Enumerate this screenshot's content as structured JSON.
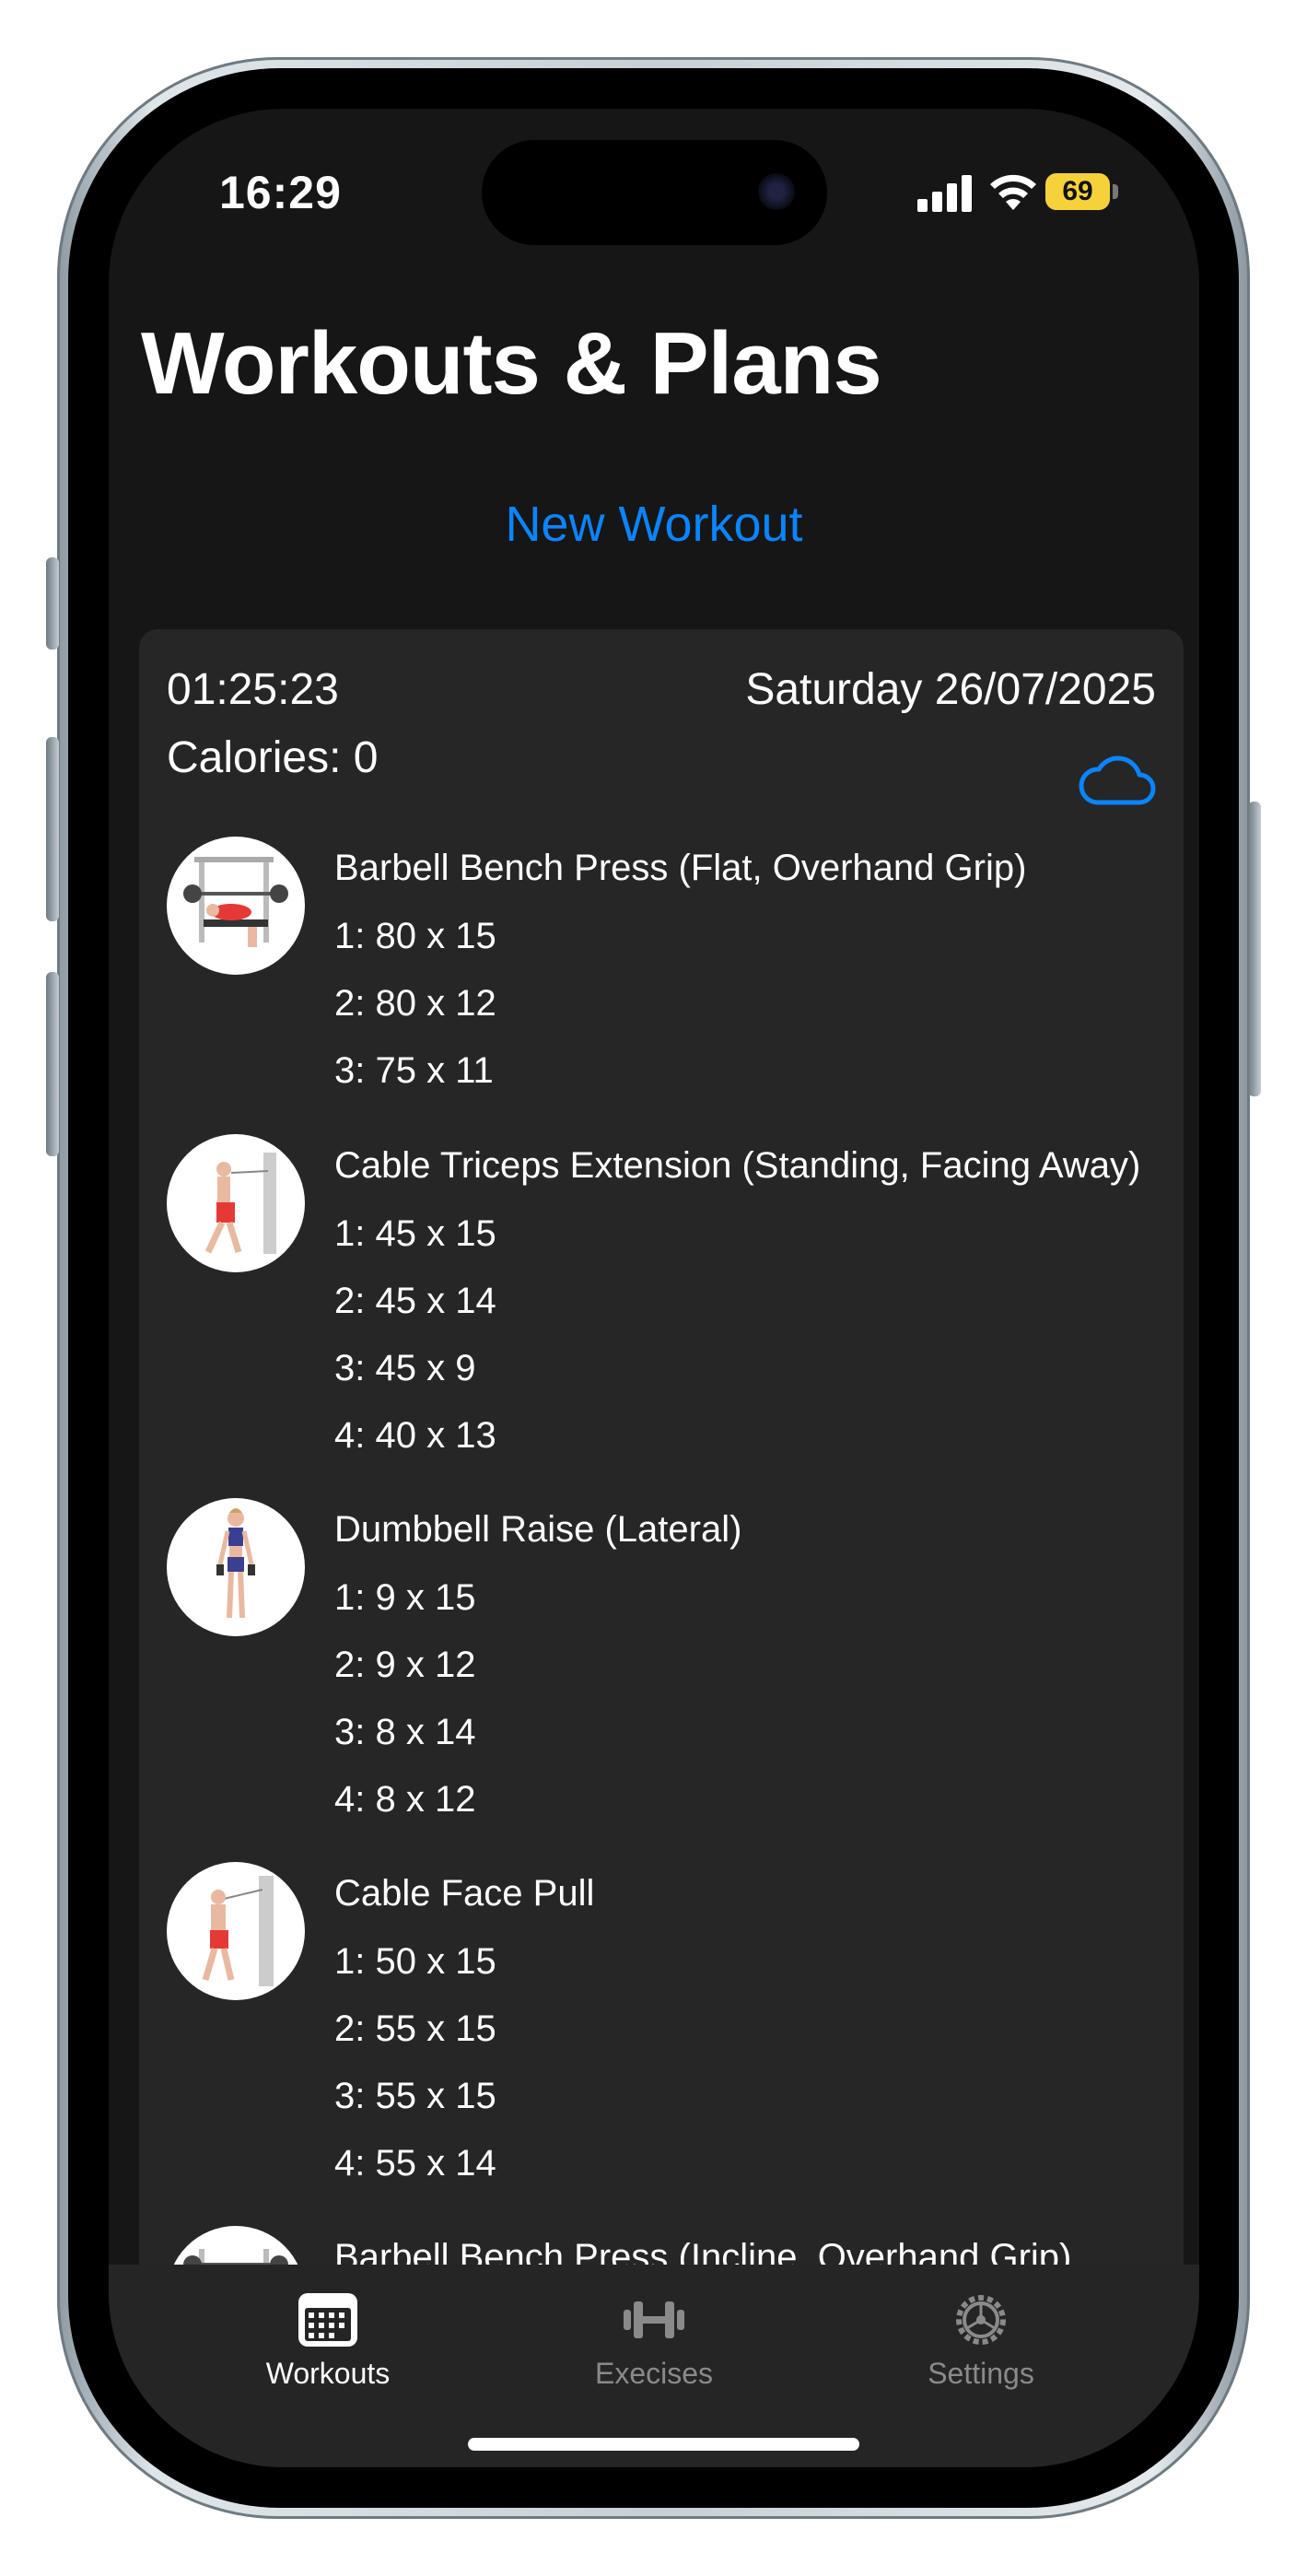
{
  "status_bar": {
    "time": "16:29",
    "battery": "69"
  },
  "header": {
    "title": "Workouts & Plans",
    "new_workout_label": "New Workout"
  },
  "workout_card": {
    "duration": "01:25:23",
    "date": "Saturday 26/07/2025",
    "calories": "Calories: 0",
    "exercises": [
      {
        "name": "Barbell Bench Press (Flat, Overhand Grip)",
        "sets": [
          "1: 80 x 15",
          "2: 80 x 12",
          "3: 75 x 11"
        ]
      },
      {
        "name": "Cable Triceps Extension (Standing, Facing Away)",
        "sets": [
          "1: 45 x 15",
          "2: 45 x 14",
          "3: 45 x 9",
          "4: 40 x 13"
        ]
      },
      {
        "name": "Dumbbell Raise (Lateral)",
        "sets": [
          "1: 9 x 15",
          "2: 9 x 12",
          "3: 8 x 14",
          "4: 8 x 12"
        ]
      },
      {
        "name": "Cable Face Pull",
        "sets": [
          "1: 50 x 15",
          "2: 55 x 15",
          "3: 55 x 15",
          "4: 55 x 14"
        ]
      },
      {
        "name": "Barbell Bench Press (Incline, Overhand Grip)",
        "sets": []
      }
    ]
  },
  "tab_bar": {
    "items": [
      {
        "label": "Workouts",
        "icon": "calendar-icon",
        "active": true
      },
      {
        "label": "Execises",
        "icon": "dumbbell-icon",
        "active": false
      },
      {
        "label": "Settings",
        "icon": "gear-icon",
        "active": false
      }
    ]
  },
  "colors": {
    "accent": "#0a84ff",
    "background": "#161616",
    "card": "#262626",
    "inactive_tab": "#8a8a8a"
  }
}
